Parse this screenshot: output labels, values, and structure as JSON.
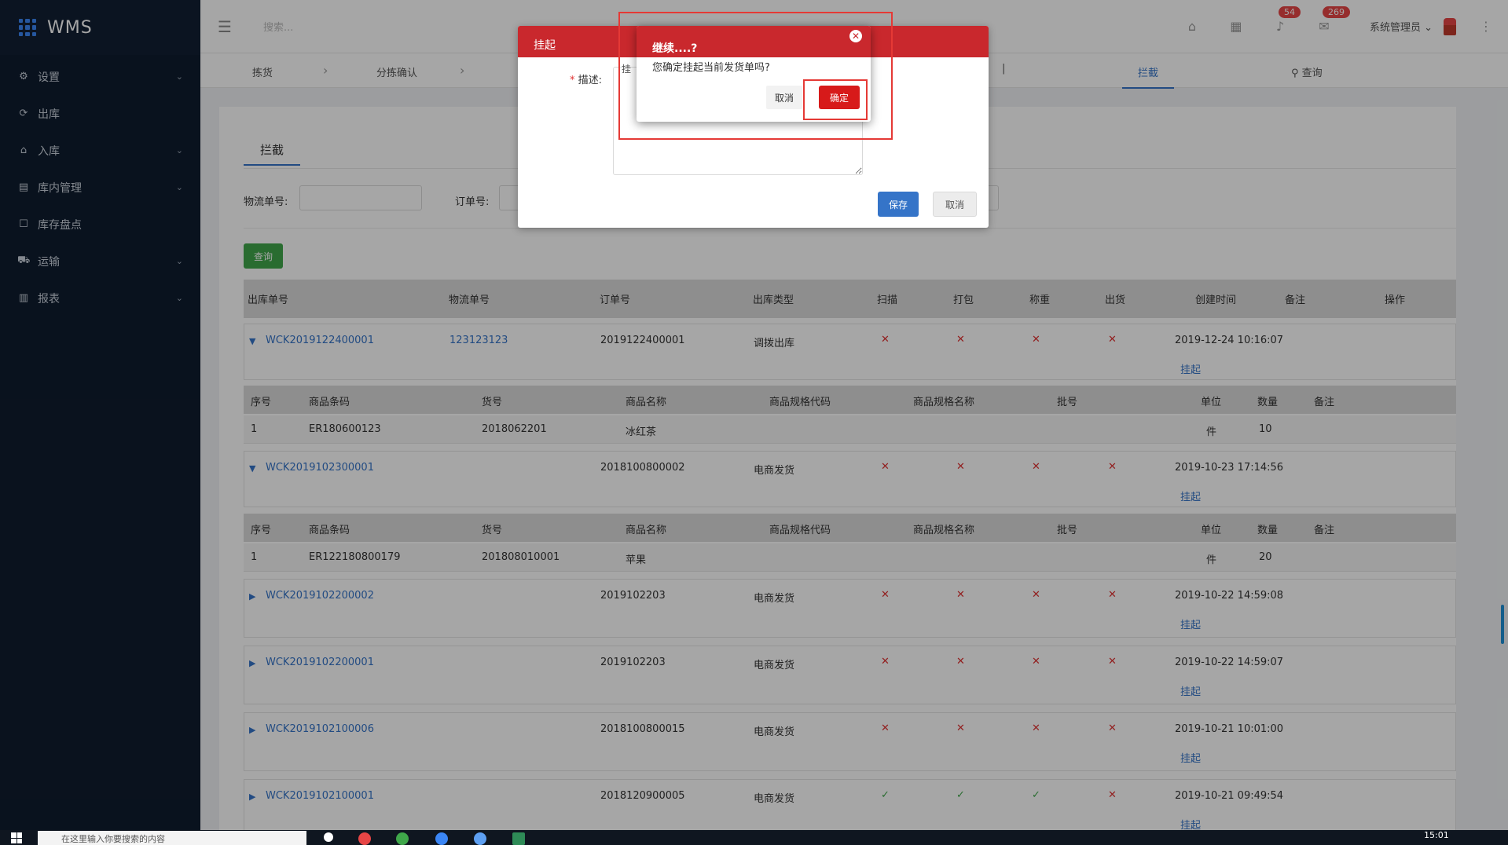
{
  "app": {
    "name": "WMS"
  },
  "sidebar": {
    "items": [
      {
        "label": "设置",
        "icon": "gear-icon",
        "expandable": true
      },
      {
        "label": "出库",
        "icon": "outbound-icon",
        "expandable": false
      },
      {
        "label": "入库",
        "icon": "inbound-icon",
        "expandable": true
      },
      {
        "label": "库内管理",
        "icon": "warehouse-icon",
        "expandable": true
      },
      {
        "label": "库存盘点",
        "icon": "inventory-icon",
        "expandable": false
      },
      {
        "label": "运输",
        "icon": "truck-icon",
        "expandable": true
      },
      {
        "label": "报表",
        "icon": "chart-icon",
        "expandable": true
      }
    ]
  },
  "topbar": {
    "search_placeholder": "搜索...",
    "notify_count": "54",
    "message_count": "269",
    "user_name": "系统管理员"
  },
  "steps": {
    "items": [
      "拣货",
      "分拣确认"
    ],
    "active_tab": "拦截",
    "query_label": "查询"
  },
  "content": {
    "tab_label": "拦截",
    "filters": {
      "logistics_label": "物流单号:",
      "order_label": "订单号:"
    },
    "query_button": "查询",
    "columns": [
      "出库单号",
      "物流单号",
      "订单号",
      "出库类型",
      "扫描",
      "打包",
      "称重",
      "出货",
      "创建时间",
      "备注",
      "操作"
    ],
    "detail_columns": [
      "序号",
      "商品条码",
      "货号",
      "商品名称",
      "商品规格代码",
      "商品规格名称",
      "批号",
      "单位",
      "数量",
      "备注"
    ],
    "orders": [
      {
        "id": "WCK2019122400001",
        "logistics": "123123123",
        "order_no": "2019122400001",
        "type": "调拨出库",
        "scan": "✕",
        "pack": "✕",
        "weigh": "✕",
        "ship": "✕",
        "created": "2019-12-24 10:16:07",
        "action": "挂起",
        "expanded": true,
        "detail": {
          "seq": "1",
          "barcode": "ER180600123",
          "sku": "2018062201",
          "name": "冰红茶",
          "unit": "件",
          "qty": "10"
        }
      },
      {
        "id": "WCK2019102300001",
        "logistics": "",
        "order_no": "2018100800002",
        "type": "电商发货",
        "scan": "✕",
        "pack": "✕",
        "weigh": "✕",
        "ship": "✕",
        "created": "2019-10-23 17:14:56",
        "action": "挂起",
        "expanded": true,
        "detail": {
          "seq": "1",
          "barcode": "ER122180800179",
          "sku": "201808010001",
          "name": "苹果",
          "unit": "件",
          "qty": "20"
        }
      },
      {
        "id": "WCK2019102200002",
        "logistics": "",
        "order_no": "2019102203",
        "type": "电商发货",
        "scan": "✕",
        "pack": "✕",
        "weigh": "✕",
        "ship": "✕",
        "created": "2019-10-22 14:59:08",
        "action": "挂起",
        "expanded": false
      },
      {
        "id": "WCK2019102200001",
        "logistics": "",
        "order_no": "2019102203",
        "type": "电商发货",
        "scan": "✕",
        "pack": "✕",
        "weigh": "✕",
        "ship": "✕",
        "created": "2019-10-22 14:59:07",
        "action": "挂起",
        "expanded": false
      },
      {
        "id": "WCK2019102100006",
        "logistics": "",
        "order_no": "2018100800015",
        "type": "电商发货",
        "scan": "✕",
        "pack": "✕",
        "weigh": "✕",
        "ship": "✕",
        "created": "2019-10-21 10:01:00",
        "action": "挂起",
        "expanded": false
      },
      {
        "id": "WCK2019102100001",
        "logistics": "",
        "order_no": "2018120900005",
        "type": "电商发货",
        "scan": "✓",
        "pack": "✓",
        "weigh": "✓",
        "ship": "✕",
        "created": "2019-10-21 09:49:54",
        "action": "挂起",
        "expanded": false
      }
    ]
  },
  "hang_dialog": {
    "title": "挂起",
    "desc_label": "描述:",
    "required_mark": "*",
    "hint_text": "挂",
    "save_button": "保存",
    "cancel_button": "取消"
  },
  "confirm_dialog": {
    "title": "继续....?",
    "message": "您确定挂起当前发货单吗?",
    "cancel_button": "取消",
    "ok_button": "确定",
    "close_glyph": "✕"
  },
  "taskbar": {
    "search_text": "在这里输入你要搜索的内容",
    "clock": "15:01"
  },
  "colors": {
    "sidebar_bg": "#0f1c2e",
    "accent": "#3574c8",
    "danger": "#d71a1a",
    "dialog_header": "#c9282d",
    "success": "#3fa74a"
  }
}
